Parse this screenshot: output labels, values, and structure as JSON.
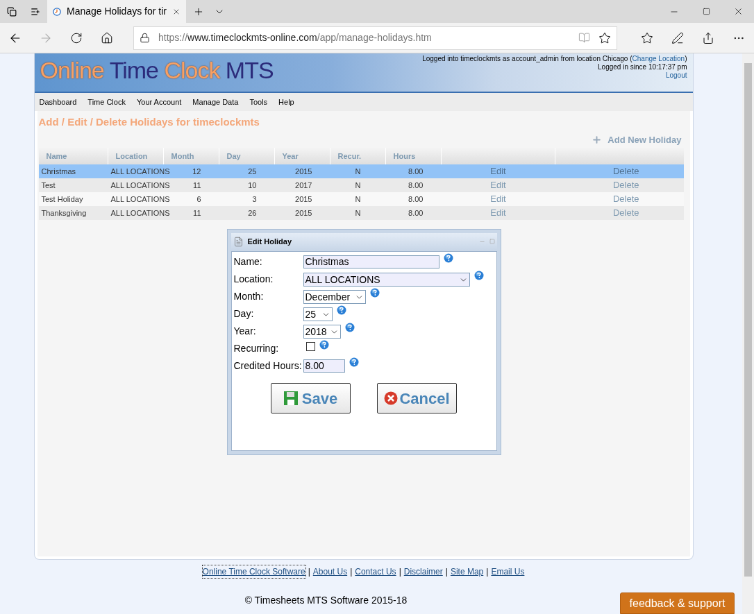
{
  "browser": {
    "tabs": [
      {
        "title": "Manage Holidays for tir",
        "selected": true
      }
    ],
    "url": {
      "scheme": "https://",
      "host": "www.timeclockmts-online.com",
      "path": "/app/manage-holidays.htm"
    }
  },
  "header": {
    "logo": [
      "Online",
      "Time",
      "Clock",
      "MTS"
    ],
    "login_text": "Logged into timeclockmts as account_admin from location Chicago (",
    "change_location": "Change Location",
    "login_close": ")",
    "since": "Logged in since 10:17:37 pm",
    "logout": "Logout"
  },
  "menu": [
    "Dashboard",
    "Time Clock",
    "Your Account",
    "Manage Data",
    "Tools",
    "Help"
  ],
  "page_title": "Add / Edit / Delete Holidays for timeclockmts",
  "add_new": "Add New Holiday",
  "table": {
    "columns": [
      "Name",
      "Location",
      "Month",
      "Day",
      "Year",
      "Recur.",
      "Hours"
    ],
    "rows": [
      {
        "cells": [
          "Christmas",
          "ALL LOCATIONS",
          "12",
          "25",
          "2015",
          "N",
          "8.00"
        ],
        "edit": "Edit",
        "delete": "Delete",
        "selected": true
      },
      {
        "cells": [
          "Test",
          "ALL LOCATIONS",
          "11",
          "10",
          "2017",
          "N",
          "8.00"
        ],
        "edit": "Edit",
        "delete": "Delete",
        "selected": false
      },
      {
        "cells": [
          "Test Holiday",
          "ALL LOCATIONS",
          "6",
          "3",
          "2015",
          "N",
          "8.00"
        ],
        "edit": "Edit",
        "delete": "Delete",
        "selected": false
      },
      {
        "cells": [
          "Thanksgiving",
          "ALL LOCATIONS",
          "11",
          "26",
          "2015",
          "N",
          "8.00"
        ],
        "edit": "Edit",
        "delete": "Delete",
        "selected": false
      }
    ]
  },
  "dialog": {
    "title": "Edit Holiday",
    "fields": [
      {
        "kind": "text",
        "label": "Name:",
        "value": "Christmas"
      },
      {
        "kind": "select",
        "label": "Location:",
        "value": "ALL LOCATIONS"
      },
      {
        "kind": "select",
        "label": "Month:",
        "value": "December"
      },
      {
        "kind": "select",
        "label": "Day:",
        "value": "25"
      },
      {
        "kind": "select",
        "label": "Year:",
        "value": "2018"
      },
      {
        "kind": "checkbox",
        "label": "Recurring:",
        "checked": false
      },
      {
        "kind": "text",
        "label": "Credited Hours:",
        "value": "8.00"
      }
    ],
    "save": "Save",
    "cancel": "Cancel"
  },
  "footer": {
    "links": [
      "Online Time Clock Software",
      "About Us",
      "Contact Us",
      "Disclaimer",
      "Site Map",
      "Email Us"
    ],
    "separator": "|",
    "copyright": "© Timesheets MTS Software 2015-18"
  },
  "feedback": "feedback & support"
}
